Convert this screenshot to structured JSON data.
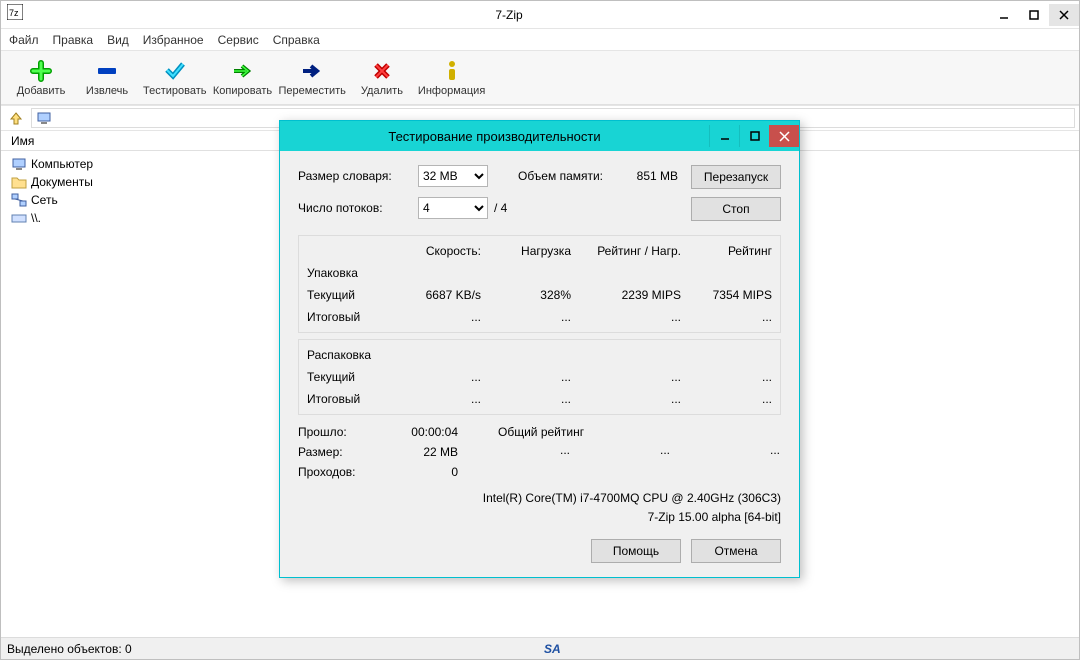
{
  "window": {
    "title": "7-Zip"
  },
  "menu": {
    "file": "Файл",
    "edit": "Правка",
    "view": "Вид",
    "favorites": "Избранное",
    "tools": "Сервис",
    "help": "Справка"
  },
  "toolbar": {
    "add": "Добавить",
    "extract": "Извлечь",
    "test": "Тестировать",
    "copy": "Копировать",
    "move": "Переместить",
    "delete": "Удалить",
    "info": "Информация"
  },
  "columns": {
    "name": "Имя"
  },
  "tree": {
    "computer": "Компьютер",
    "documents": "Документы",
    "network": "Сеть",
    "root": "\\\\."
  },
  "status": {
    "selected": "Выделено объектов: 0"
  },
  "dialog": {
    "title": "Тестирование производительности",
    "dict_size_label": "Размер словаря:",
    "dict_size_value": "32 MB",
    "memory_label": "Объем памяти:",
    "memory_value": "851 MB",
    "threads_label": "Число потоков:",
    "threads_value": "4",
    "threads_max": "/ 4",
    "restart": "Перезапуск",
    "stop": "Стоп",
    "col_speed": "Скорость:",
    "col_usage": "Нагрузка",
    "col_rating_usage": "Рейтинг / Нагр.",
    "col_rating": "Рейтинг",
    "packing": "Упаковка",
    "current": "Текущий",
    "result": "Итоговый",
    "unpacking": "Распаковка",
    "pack_speed": "6687 KB/s",
    "pack_usage": "328%",
    "pack_rate_usage": "2239 MIPS",
    "pack_rating": "7354 MIPS",
    "ellipsis": "...",
    "elapsed_label": "Прошло:",
    "elapsed_value": "00:00:04",
    "size_label": "Размер:",
    "size_value": "22 MB",
    "passes_label": "Проходов:",
    "passes_value": "0",
    "overall_label": "Общий рейтинг",
    "cpu": "Intel(R) Core(TM) i7-4700MQ CPU @ 2.40GHz (306C3)",
    "version": "7-Zip 15.00 alpha [64-bit]",
    "help": "Помощь",
    "cancel": "Отмена"
  }
}
